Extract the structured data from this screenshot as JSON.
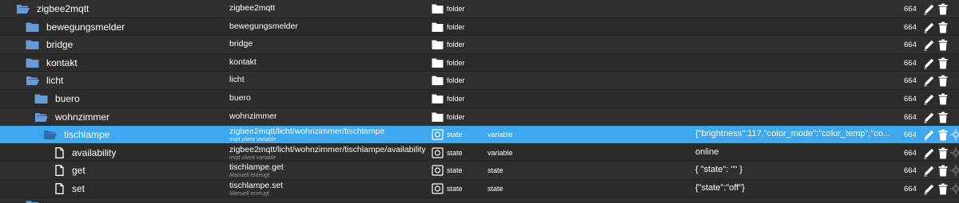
{
  "rows": [
    {
      "name": "zigbee2mqtt",
      "full": "zigbee2mqtt",
      "sub": "",
      "type": "folder",
      "role": "",
      "value": "",
      "acl": "664",
      "open": true,
      "level": 0
    },
    {
      "name": "bewegungsmelder",
      "full": "bewegungsmelder",
      "sub": "",
      "type": "folder",
      "role": "",
      "value": "",
      "acl": "664",
      "open": false,
      "level": 1
    },
    {
      "name": "bridge",
      "full": "bridge",
      "sub": "",
      "type": "folder",
      "role": "",
      "value": "",
      "acl": "664",
      "open": false,
      "level": 1
    },
    {
      "name": "kontakt",
      "full": "kontakt",
      "sub": "",
      "type": "folder",
      "role": "",
      "value": "",
      "acl": "664",
      "open": false,
      "level": 1
    },
    {
      "name": "licht",
      "full": "licht",
      "sub": "",
      "type": "folder",
      "role": "",
      "value": "",
      "acl": "664",
      "open": true,
      "level": 1
    },
    {
      "name": "buero",
      "full": "buero",
      "sub": "",
      "type": "folder",
      "role": "",
      "value": "",
      "acl": "664",
      "open": false,
      "level": 2
    },
    {
      "name": "wohnzimmer",
      "full": "wohnzimmer",
      "sub": "",
      "type": "folder",
      "role": "",
      "value": "",
      "acl": "664",
      "open": true,
      "level": 2
    },
    {
      "name": "tischlampe",
      "full": "zigbee2mqtt/licht/wohnzimmer/tischlampe",
      "sub": "mqtt client variable",
      "type": "state",
      "role": "variable",
      "value": "{\"brightness\":117,\"color_mode\":\"color_temp\",\"co...",
      "acl": "664",
      "open": true,
      "level": 3,
      "selected": true
    },
    {
      "name": "availability",
      "full": "zigbee2mqtt/licht/wohnzimmer/tischlampe/availability",
      "sub": "mqtt client variable",
      "type": "state",
      "role": "variable",
      "value": "online",
      "acl": "664",
      "level": 4
    },
    {
      "name": "get",
      "full": "tischlampe.get",
      "sub": "Manuell erzeugt",
      "type": "state",
      "role": "state",
      "value": "{ \"state\": \"\" }",
      "acl": "664",
      "level": 4
    },
    {
      "name": "set",
      "full": "tischlampe.set",
      "sub": "Manuell erzeugt",
      "type": "state",
      "role": "state",
      "value": "{\"state\":\"off\"}",
      "acl": "664",
      "level": 4
    }
  ]
}
